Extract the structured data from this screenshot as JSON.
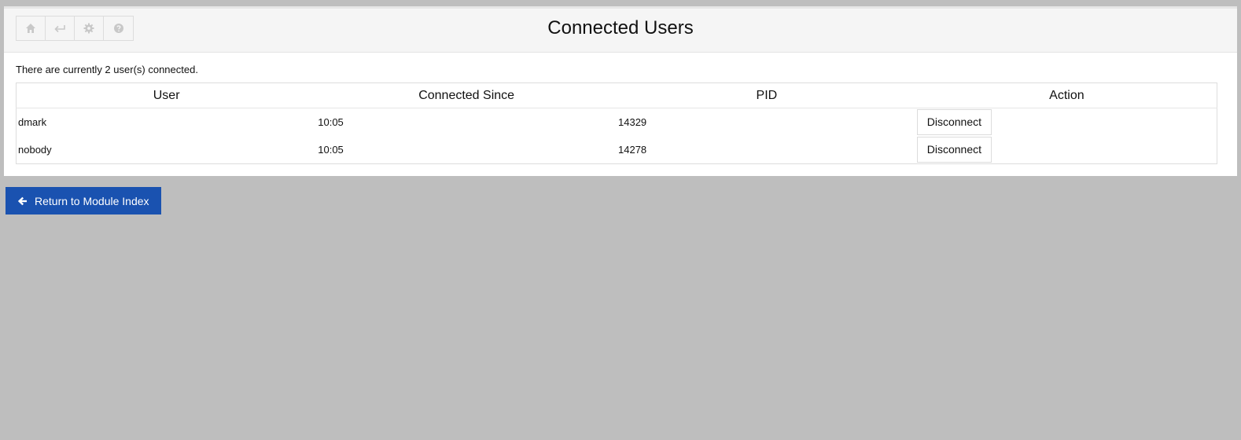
{
  "toolbar": {
    "buttons": [
      {
        "icon": "home-icon"
      },
      {
        "icon": "back-arrow-icon"
      },
      {
        "icon": "gear-icon"
      },
      {
        "icon": "help-icon"
      }
    ],
    "icon_color": "#c8c8c8"
  },
  "page": {
    "title": "Connected Users",
    "summary": "There are currently 2 user(s) connected."
  },
  "table": {
    "headers": {
      "user": "User",
      "since": "Connected Since",
      "pid": "PID",
      "action": "Action"
    },
    "rows": [
      {
        "user": "dmark",
        "since": "10:05",
        "pid": "14329",
        "action": "Disconnect"
      },
      {
        "user": "nobody",
        "since": "10:05",
        "pid": "14278",
        "action": "Disconnect"
      }
    ]
  },
  "footer": {
    "return_label": "Return to Module Index",
    "return_icon": "arrow-left-icon"
  },
  "colors": {
    "background": "#bebebe",
    "panel": "#ffffff",
    "header": "#f5f5f5",
    "primary_button": "#1a52b0"
  }
}
